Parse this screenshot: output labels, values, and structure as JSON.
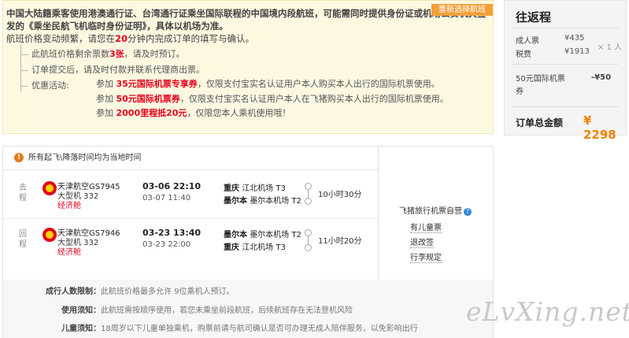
{
  "notice": {
    "line1": "中国大陆籍乘客使用港澳通行证、台湾通行证乘坐国际联程的中国境内段航班，可能需同时提供身份证或机场公安机关签发的《乘坐民航飞机临时身份证明》，具体以机场为准。",
    "line2_a": "航班价格变动频繁，请您在",
    "line2_num": "20",
    "line2_b": "分钟内完成订单的填写与确认。",
    "tree_item1_a": "此航班价格剩余票数",
    "tree_item1_num": "3张",
    "tree_item1_b": "，请及时预订。",
    "tree_item2": "订单提交后，请及时付款并联系代理商出票。",
    "tree_item3_label": "优惠活动:",
    "promos": [
      {
        "prefix": "参加",
        "highlight": "35元国际机票专享券",
        "suffix": "，仅限支付宝实名认证用户本人购买本人出行的国际机票使用。"
      },
      {
        "prefix": "参加",
        "highlight": "50元国际机票券",
        "suffix": "，仅限支付宝实名认证用户本人在飞猪购买本人出行的国际机票使用。"
      },
      {
        "prefix": "参加",
        "highlight": "2000里程抵20元",
        "suffix": "，仅限您本人乘机使用哦！"
      }
    ]
  },
  "summary": {
    "title": "往返程",
    "adult_label": "成人票",
    "adult_price": "¥435",
    "multiplier": "× 1 人",
    "tax_label": "税费",
    "tax_price": "¥1913",
    "coupon_label": "50元国际机票券",
    "coupon_value": "-¥50",
    "total_label": "订单总金额",
    "total_value": "¥ 2298"
  },
  "flights": {
    "header": "所有起飞\\降落时间均为当地时间",
    "reselect": "重新选择航班",
    "legs": [
      {
        "name": "去程",
        "airline": "天津航空GS7945",
        "plane": "大型机 332",
        "cabin": "经济舱",
        "dep_time": "03-06 22:10",
        "arr_time": "03-07 11:40",
        "dep_city": "重庆",
        "dep_airport": "江北机场 T3",
        "arr_city": "墨尔本",
        "arr_airport": "墨尔本机场 T2",
        "duration": "10小时30分"
      },
      {
        "name": "回程",
        "airline": "天津航空GS7946",
        "plane": "大型机 332",
        "cabin": "经济舱",
        "dep_time": "03-23 13:40",
        "arr_time": "03-23 22:00",
        "dep_city": "墨尔本",
        "dep_airport": "墨尔本机场 T2",
        "arr_city": "重庆",
        "arr_airport": "江北机场 T3",
        "duration": "11小时20分"
      }
    ],
    "agent": "飞猪旅行机票自营",
    "links": [
      "有儿童票",
      "退改签",
      "行李规定"
    ]
  },
  "details": {
    "rows": [
      {
        "key": "成行人数限制：",
        "value": "此航班价格最多允许 9位乘机人预订。"
      },
      {
        "key": "使用须知：",
        "value": "此航班需按顺序使用，若您未乘坐前段航班，后续航班存在无法登机风险"
      },
      {
        "key": "儿童须知：",
        "value": "18周岁以下儿童单独乘机，购票前请与航司确认是否可办理无成人陪伴服务，以免影响出行"
      }
    ]
  },
  "watermark": "eLvXing.net",
  "colors": {
    "accent_orange": "#f08300",
    "red": "#e4001b",
    "green": "#3a9a18",
    "notice_bg": "#fdf9e1"
  }
}
